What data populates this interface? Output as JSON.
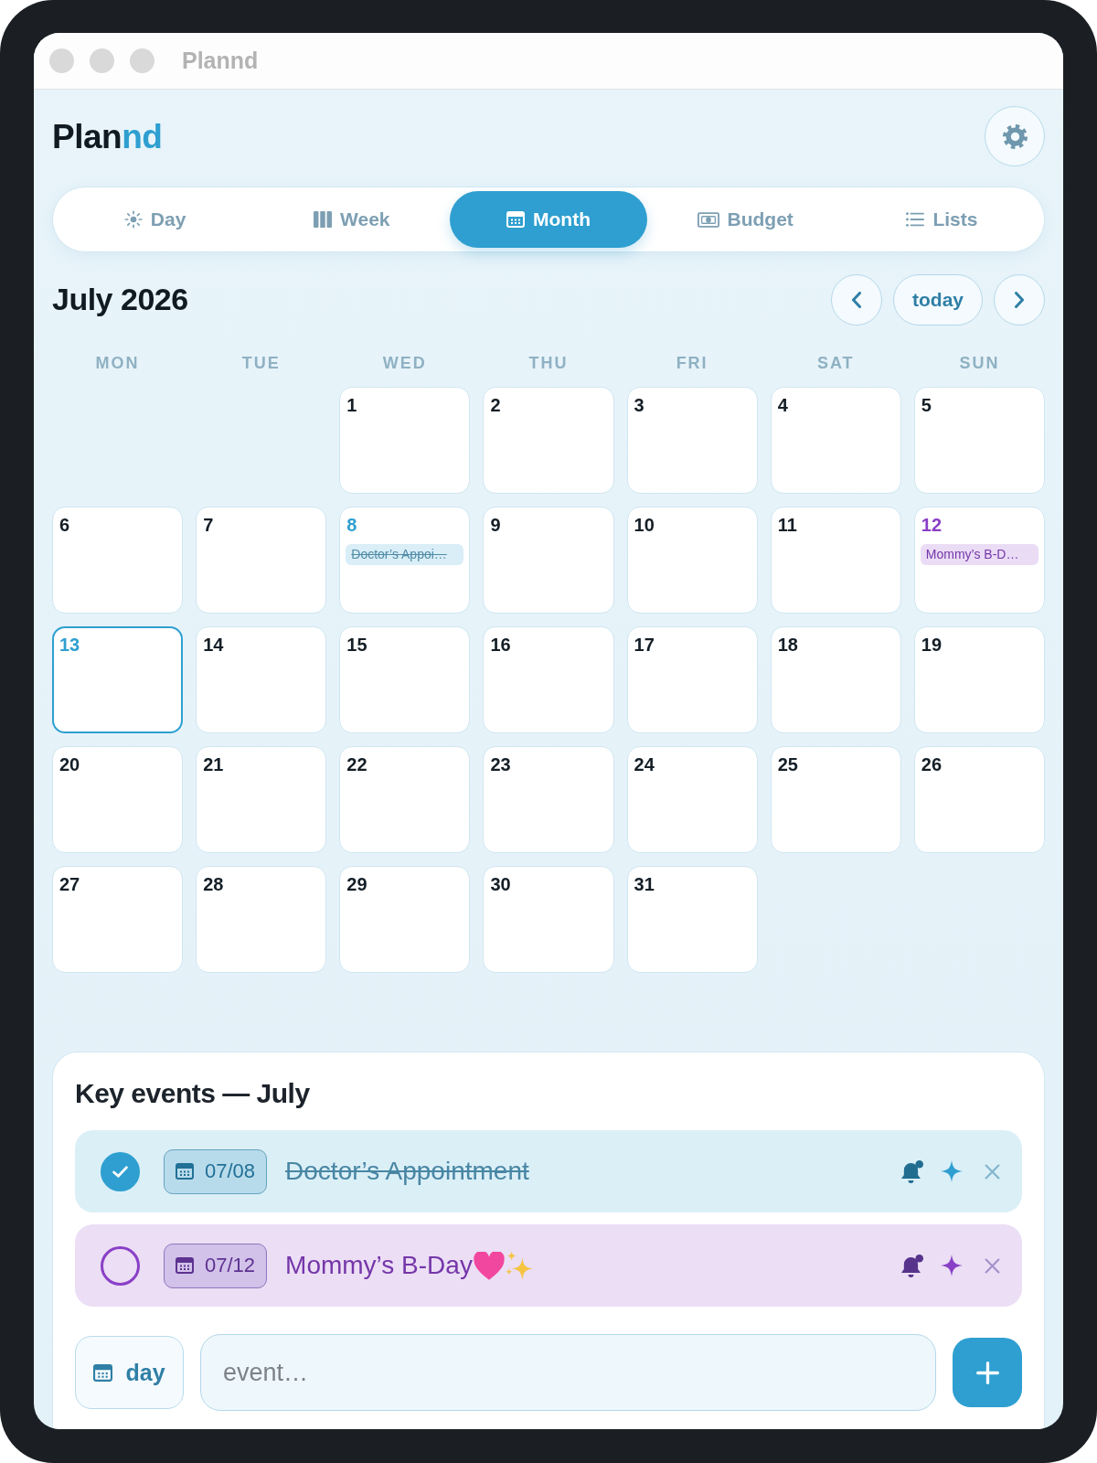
{
  "window": {
    "title": "Plannd"
  },
  "header": {
    "logo": [
      {
        "text": "Plan",
        "accent": false
      },
      {
        "text": "nd",
        "accent": true
      }
    ]
  },
  "tabs": [
    {
      "label": "Day",
      "kind": "day",
      "selected": false
    },
    {
      "label": "Week",
      "kind": "week",
      "selected": false
    },
    {
      "label": "Month",
      "kind": "month",
      "selected": true
    },
    {
      "label": "Budget",
      "kind": "budget",
      "selected": false
    },
    {
      "label": "Lists",
      "kind": "lists",
      "selected": false
    }
  ],
  "calendar": {
    "title": "July 2026",
    "today_button": "today",
    "weekdays": [
      "MON",
      "TUE",
      "WED",
      "THU",
      "FRI",
      "SAT",
      "SUN"
    ],
    "weeks": [
      {
        "right_aligned": true,
        "days": [
          {
            "day": "1",
            "today": false
          },
          {
            "day": "2",
            "today": false
          },
          {
            "day": "3",
            "today": false
          },
          {
            "day": "4",
            "today": false
          },
          {
            "day": "5",
            "today": false
          }
        ]
      },
      {
        "days": [
          {
            "day": "6",
            "today": false
          },
          {
            "day": "7",
            "today": false
          },
          {
            "day": "8",
            "today": false,
            "events": [
              {
                "title": "Doctor’s Appoi…",
                "done": true,
                "color": "#2e9fd0"
              }
            ]
          },
          {
            "day": "9",
            "today": false
          },
          {
            "day": "10",
            "today": false
          },
          {
            "day": "11",
            "today": false
          },
          {
            "day": "12",
            "today": false,
            "events": [
              {
                "title": "Mommy’s B-D…",
                "done": false,
                "color": "#8a3fc7"
              }
            ]
          }
        ]
      },
      {
        "days": [
          {
            "day": "13",
            "today": true
          },
          {
            "day": "14",
            "today": false
          },
          {
            "day": "15",
            "today": false
          },
          {
            "day": "16",
            "today": false
          },
          {
            "day": "17",
            "today": false
          },
          {
            "day": "18",
            "today": false
          },
          {
            "day": "19",
            "today": false
          }
        ]
      },
      {
        "days": [
          {
            "day": "20",
            "today": false
          },
          {
            "day": "21",
            "today": false
          },
          {
            "day": "22",
            "today": false
          },
          {
            "day": "23",
            "today": false
          },
          {
            "day": "24",
            "today": false
          },
          {
            "day": "25",
            "today": false
          },
          {
            "day": "26",
            "today": false
          }
        ]
      },
      {
        "right_aligned": false,
        "days": [
          {
            "day": "27",
            "today": false
          },
          {
            "day": "28",
            "today": false
          },
          {
            "day": "29",
            "today": false
          },
          {
            "day": "30",
            "today": false
          },
          {
            "day": "31",
            "today": false
          }
        ]
      }
    ]
  },
  "key_events": {
    "title": "Key events — July",
    "events": [
      {
        "date": "07/08",
        "title": "Doctor’s Appointment",
        "kind": "appointment",
        "done": true,
        "color": "#2e9fd0"
      },
      {
        "date": "07/12",
        "title": "Mommy’s B-Day",
        "kind": "birthday",
        "done": false,
        "color": "#8a3fc7"
      }
    ]
  },
  "composer": {
    "day_button": "day",
    "placeholder": "event…"
  }
}
